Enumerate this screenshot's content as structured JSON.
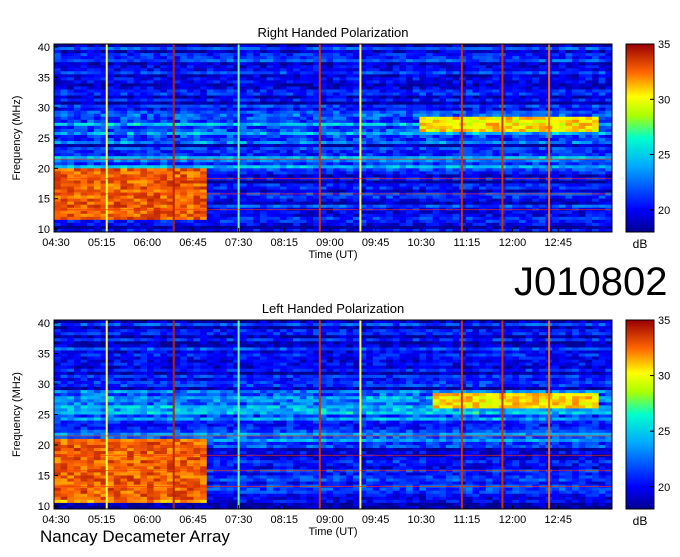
{
  "observation_id": "J010802",
  "instrument": "Nancay Decameter Array",
  "chart_data": [
    {
      "type": "heatmap",
      "title": "Right Handed Polarization",
      "xlabel": "Time (UT)",
      "ylabel": "Frequency (MHz)",
      "x_tick_labels": [
        "04:30",
        "05:15",
        "06:00",
        "06:45",
        "07:30",
        "08:15",
        "09:00",
        "09:45",
        "10:30",
        "11:15",
        "12:00",
        "12:45"
      ],
      "y_ticks": [
        10,
        15,
        20,
        25,
        30,
        35,
        40
      ],
      "ylim": [
        10,
        40
      ],
      "colorbar": {
        "label": "dB",
        "ticks": [
          20,
          25,
          30,
          35
        ],
        "range": [
          18,
          35
        ]
      },
      "features": {
        "strong_emission_low_freq": {
          "t_start": "04:30",
          "t_end": "07:00",
          "f_range_mhz": [
            12,
            20
          ],
          "level_db": 34
        },
        "band_27mhz": {
          "t_start": "10:30",
          "t_end": "13:30",
          "f_mhz": 27,
          "level_db": 32
        }
      }
    },
    {
      "type": "heatmap",
      "title": "Left Handed Polarization",
      "xlabel": "Time (UT)",
      "ylabel": "Frequency (MHz)",
      "x_tick_labels": [
        "04:30",
        "05:15",
        "06:00",
        "06:45",
        "07:30",
        "08:15",
        "09:00",
        "09:45",
        "10:30",
        "11:15",
        "12:00",
        "12:45"
      ],
      "y_ticks": [
        10,
        15,
        20,
        25,
        30,
        35,
        40
      ],
      "ylim": [
        10,
        40
      ],
      "colorbar": {
        "label": "dB",
        "ticks": [
          20,
          25,
          30,
          35
        ],
        "range": [
          18,
          35
        ]
      },
      "features": {
        "strong_emission_low_freq": {
          "t_start": "04:30",
          "t_end": "07:00",
          "f_range_mhz": [
            11,
            21
          ],
          "level_db": 34
        },
        "band_27mhz": {
          "t_start": "10:45",
          "t_end": "13:30",
          "f_mhz": 27,
          "level_db": 32
        }
      }
    }
  ]
}
